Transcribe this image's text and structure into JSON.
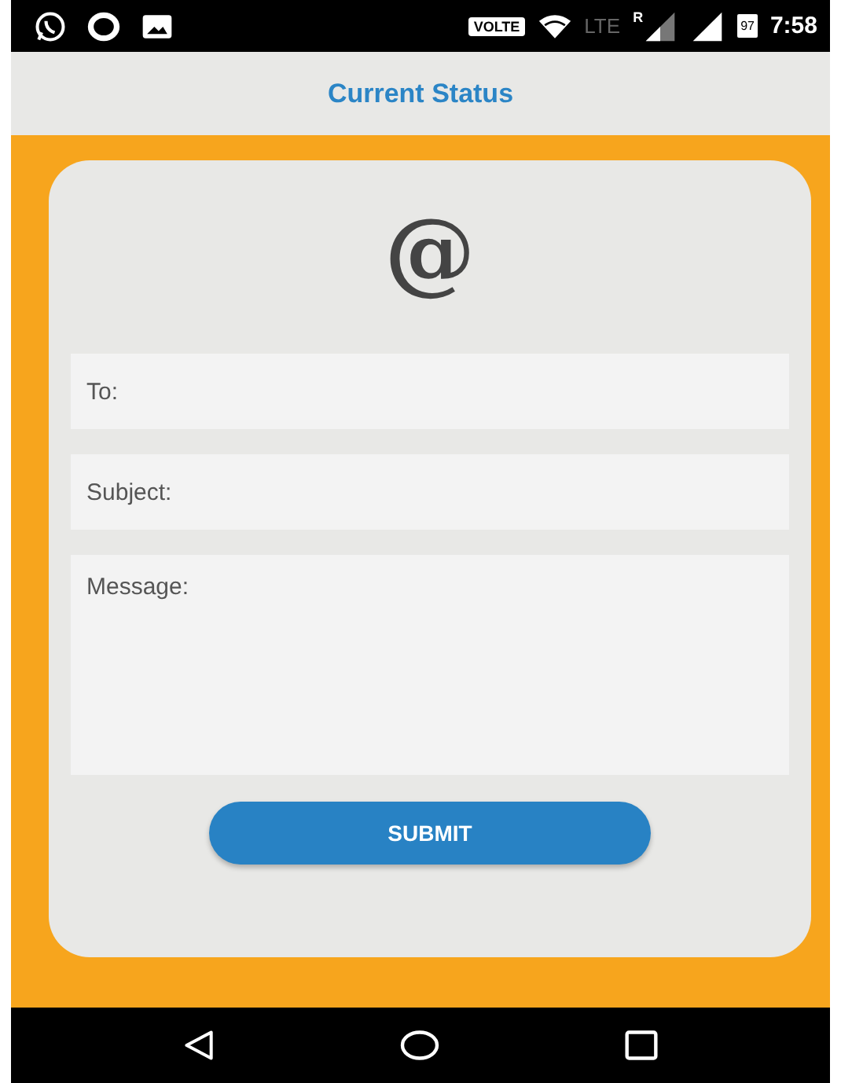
{
  "status_bar": {
    "volte": "VOLTE",
    "network": "LTE",
    "roaming": "R",
    "battery": "97",
    "time": "7:58"
  },
  "app_bar": {
    "title": "Current Status"
  },
  "form": {
    "logo": "@",
    "fields": [
      {
        "kind": "line",
        "placeholder": "To:"
      },
      {
        "kind": "line",
        "placeholder": "Subject:"
      },
      {
        "kind": "area",
        "placeholder": "Message:"
      }
    ],
    "submit": "SUBMIT"
  }
}
